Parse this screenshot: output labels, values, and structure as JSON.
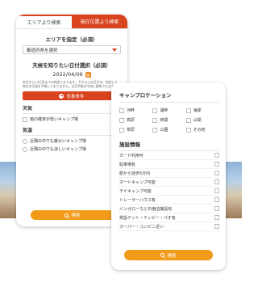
{
  "left": {
    "tabs": [
      {
        "label": "エリアより検索",
        "active": true
      },
      {
        "label": "現在位置より検索",
        "active": false
      }
    ],
    "area_title": "エリアを指定（必須）",
    "prefecture_placeholder": "都道府県を選択",
    "date_title": "天候を知りたい日付選択（必須）",
    "date_value": "2022/04/06",
    "calendar_icon": "calendar-icon",
    "note": "本日から14日目までの指定となります。それ以上の日付は、指定した地点の天候を予報しておりません。当日予報は午前に更新されます。",
    "weather_conditions_label": "気象条件",
    "weather_group": "天気",
    "weather_option": "雨の確率が低いキャンプ場",
    "temp_group": "気温",
    "temp_options": [
      "近隣の中でも暖かいキャンプ場",
      "近隣の中でも涼しいキャンプ場"
    ],
    "search_label": "検索",
    "accent": "#d9431e",
    "button_color": "#f29b1a"
  },
  "right": {
    "location_title": "キャンプロケーション",
    "locations": [
      "河畔",
      "湖畔",
      "海岸",
      "高原",
      "林間",
      "山間",
      "草原",
      "公園",
      "その他"
    ],
    "facilities_title": "施設情報",
    "facilities": [
      "カード利用可",
      "駐車場有",
      "駅から徒歩5分内",
      "オートキャンプ可能",
      "デイキャンプ可能",
      "トレーラーハウス有",
      "バンガローなどの宿泊施設有",
      "常設テント・ティピー・パオ有",
      "スーパー・コンビニ近い"
    ],
    "search_label": "検索"
  }
}
